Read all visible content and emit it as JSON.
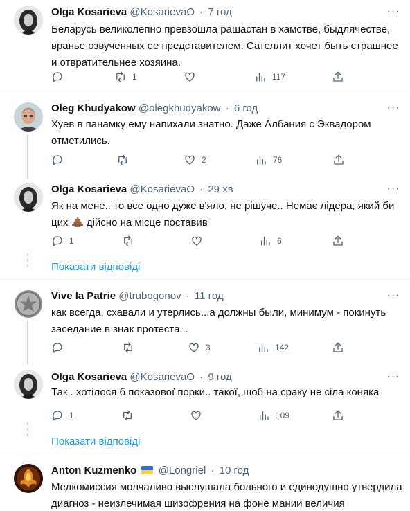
{
  "tweets": [
    {
      "name": "Olga Kosarieva",
      "handle": "@KosarievaO",
      "time": "7 год",
      "text": "Беларусь великолепно превзошла рашастан в хамстве, быдлячестве, вранье озвученных ее представителем. Сателлит хочет быть страшнее и отвратительнее хозяина.",
      "replies": "",
      "retweets": "1",
      "likes": "",
      "views": "117"
    },
    {
      "name": "Oleg Khudyakow",
      "handle": "@olegkhudyakow",
      "time": "6 год",
      "text": "Хуев в панамку ему напихали знатно. Даже Албания с Эквадором отметились.",
      "replies": "",
      "retweets": "",
      "likes": "2",
      "views": "76"
    },
    {
      "name": "Olga Kosarieva",
      "handle": "@KosarievaO",
      "time": "29 хв",
      "text_before": "Як на мене.. то все одно дуже в'яло, не рішуче.. Немає лідера, який би цих",
      "text_after": "дійсно на місце поставив",
      "replies": "1",
      "retweets": "",
      "likes": "",
      "views": "6",
      "show_replies": "Показати відповіді"
    },
    {
      "name": "Vive la Patrie",
      "handle": "@trubogonov",
      "time": "11 год",
      "text": "как всегда, схавали и утерлись...а должны были,  минимум - покинуть заседание в знак протеста...",
      "replies": "",
      "retweets": "",
      "likes": "3",
      "views": "142"
    },
    {
      "name": "Olga Kosarieva",
      "handle": "@KosarievaO",
      "time": "9 год",
      "text": "Так.. хотілося б показової порки.. такої, шоб на сраку не сіла коняка",
      "replies": "1",
      "retweets": "",
      "likes": "",
      "views": "109",
      "show_replies": "Показати відповіді"
    },
    {
      "name": "Anton Kuzmenko",
      "handle": "@Longriel",
      "time": "10 год",
      "text": "Медкомиссия молчаливо выслушала больного и единодушно утвердила диагноз - неизлечимая шизофрения на фоне мании величия"
    }
  ],
  "more_glyph": "···",
  "dot": "·",
  "colors": {
    "accent": "#1d9bf0",
    "secondary_text": "#536471",
    "separator": "#eff3f4"
  },
  "icons": [
    "reply-icon",
    "retweet-icon",
    "like-icon",
    "views-icon",
    "share-icon",
    "more-icon",
    "poop-emoji",
    "ukraine-flag-emoji"
  ]
}
